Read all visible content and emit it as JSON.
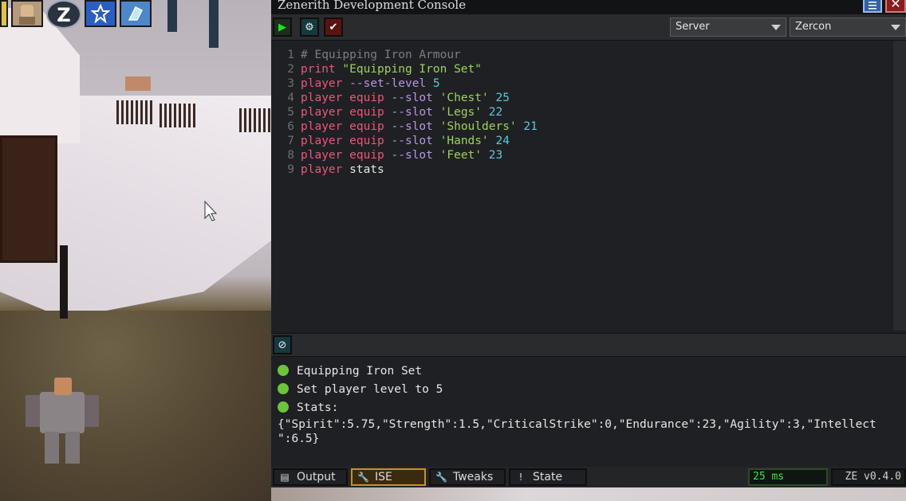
{
  "window": {
    "title": "Zenerith Development Console"
  },
  "toolbar": {
    "server_select": "Server",
    "context_select": "Zercon"
  },
  "editor": {
    "lines": [
      {
        "n": "1",
        "tokens": [
          {
            "c": "cm",
            "t": "# Equipping Iron Armour"
          }
        ]
      },
      {
        "n": "2",
        "tokens": [
          {
            "c": "kw",
            "t": "print"
          },
          {
            "c": "id",
            "t": " "
          },
          {
            "c": "st",
            "t": "\"Equipping Iron Set\""
          }
        ]
      },
      {
        "n": "3",
        "tokens": [
          {
            "c": "kw",
            "t": "player"
          },
          {
            "c": "id",
            "t": " "
          },
          {
            "c": "fl",
            "t": "--set-level"
          },
          {
            "c": "id",
            "t": " "
          },
          {
            "c": "nm",
            "t": "5"
          }
        ]
      },
      {
        "n": "4",
        "tokens": [
          {
            "c": "kw",
            "t": "player"
          },
          {
            "c": "id",
            "t": " "
          },
          {
            "c": "kw",
            "t": "equip"
          },
          {
            "c": "id",
            "t": " "
          },
          {
            "c": "fl",
            "t": "--slot"
          },
          {
            "c": "id",
            "t": " "
          },
          {
            "c": "st",
            "t": "'Chest'"
          },
          {
            "c": "id",
            "t": " "
          },
          {
            "c": "nm",
            "t": "25"
          }
        ]
      },
      {
        "n": "5",
        "tokens": [
          {
            "c": "kw",
            "t": "player"
          },
          {
            "c": "id",
            "t": " "
          },
          {
            "c": "kw",
            "t": "equip"
          },
          {
            "c": "id",
            "t": " "
          },
          {
            "c": "fl",
            "t": "--slot"
          },
          {
            "c": "id",
            "t": " "
          },
          {
            "c": "st",
            "t": "'Legs'"
          },
          {
            "c": "id",
            "t": " "
          },
          {
            "c": "nm",
            "t": "22"
          }
        ]
      },
      {
        "n": "6",
        "tokens": [
          {
            "c": "kw",
            "t": "player"
          },
          {
            "c": "id",
            "t": " "
          },
          {
            "c": "kw",
            "t": "equip"
          },
          {
            "c": "id",
            "t": " "
          },
          {
            "c": "fl",
            "t": "--slot"
          },
          {
            "c": "id",
            "t": " "
          },
          {
            "c": "st",
            "t": "'Shoulders'"
          },
          {
            "c": "id",
            "t": " "
          },
          {
            "c": "nm",
            "t": "21"
          }
        ]
      },
      {
        "n": "7",
        "tokens": [
          {
            "c": "kw",
            "t": "player"
          },
          {
            "c": "id",
            "t": " "
          },
          {
            "c": "kw",
            "t": "equip"
          },
          {
            "c": "id",
            "t": " "
          },
          {
            "c": "fl",
            "t": "--slot"
          },
          {
            "c": "id",
            "t": " "
          },
          {
            "c": "st",
            "t": "'Hands'"
          },
          {
            "c": "id",
            "t": " "
          },
          {
            "c": "nm",
            "t": "24"
          }
        ]
      },
      {
        "n": "8",
        "tokens": [
          {
            "c": "kw",
            "t": "player"
          },
          {
            "c": "id",
            "t": " "
          },
          {
            "c": "kw",
            "t": "equip"
          },
          {
            "c": "id",
            "t": " "
          },
          {
            "c": "fl",
            "t": "--slot"
          },
          {
            "c": "id",
            "t": " "
          },
          {
            "c": "st",
            "t": "'Feet'"
          },
          {
            "c": "id",
            "t": " "
          },
          {
            "c": "nm",
            "t": "23"
          }
        ]
      },
      {
        "n": "9",
        "tokens": [
          {
            "c": "kw",
            "t": "player"
          },
          {
            "c": "id",
            "t": " stats"
          }
        ]
      }
    ]
  },
  "output": {
    "rows": [
      "Equipping Iron Set",
      "Set player level to 5",
      "Stats:"
    ],
    "json_line1": "{\"Spirit\":5.75,\"Strength\":1.5,\"CriticalStrike\":0,\"Endurance\":23,\"Agility\":3,\"Intellect",
    "json_line2": "\":6.5}"
  },
  "tabs": [
    {
      "label": "Output",
      "icon": "list-icon"
    },
    {
      "label": "ISE",
      "icon": "wrench-icon"
    },
    {
      "label": "Tweaks",
      "icon": "wrench-icon"
    },
    {
      "label": "State",
      "icon": "alert-icon"
    }
  ],
  "status": {
    "latency": "25 ms",
    "version": "ZE v0.4.0"
  },
  "colors": {
    "accent_active_tab": "#c7902f",
    "success_dot": "#6bc43b",
    "run_green": "#1fe01f",
    "close_red": "#8a1d1d"
  }
}
